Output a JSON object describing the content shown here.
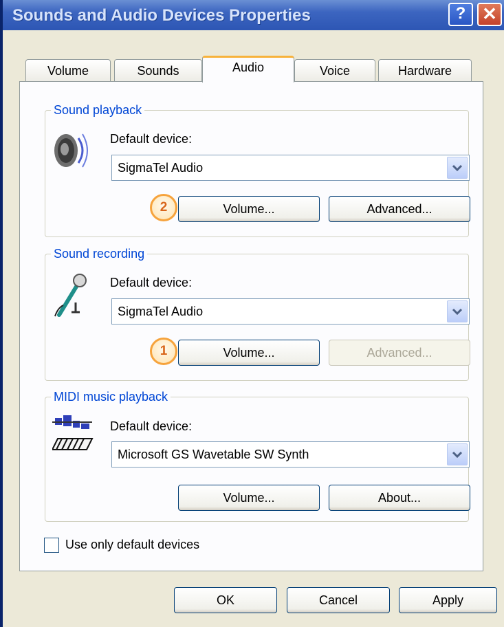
{
  "window": {
    "title": "Sounds and Audio Devices Properties",
    "help_label": "?",
    "close_label": "✕"
  },
  "tabs": [
    {
      "label": "Volume",
      "active": false
    },
    {
      "label": "Sounds",
      "active": false
    },
    {
      "label": "Audio",
      "active": true
    },
    {
      "label": "Voice",
      "active": false
    },
    {
      "label": "Hardware",
      "active": false
    }
  ],
  "playback": {
    "group_label": "Sound playback",
    "icon": "speaker-icon",
    "device_label": "Default device:",
    "device_value": "SigmaTel Audio",
    "volume_label": "Volume...",
    "advanced_label": "Advanced...",
    "badge": "2"
  },
  "recording": {
    "group_label": "Sound recording",
    "icon": "microphone-icon",
    "device_label": "Default device:",
    "device_value": "SigmaTel Audio",
    "volume_label": "Volume...",
    "advanced_label": "Advanced...",
    "advanced_disabled": true,
    "badge": "1"
  },
  "midi": {
    "group_label": "MIDI music playback",
    "icon": "midi-keyboard-icon",
    "device_label": "Default device:",
    "device_value": "Microsoft GS Wavetable SW Synth",
    "volume_label": "Volume...",
    "about_label": "About..."
  },
  "use_default_only": {
    "label": "Use only default devices",
    "checked": false
  },
  "footer": {
    "ok_label": "OK",
    "cancel_label": "Cancel",
    "apply_label": "Apply"
  },
  "colors": {
    "titlebar": "#2d56b4",
    "dialog_bg": "#ece9d8",
    "group_label": "#0046d5",
    "badge_border": "#f6a33c",
    "active_tab_accent": "#f7b23b"
  }
}
